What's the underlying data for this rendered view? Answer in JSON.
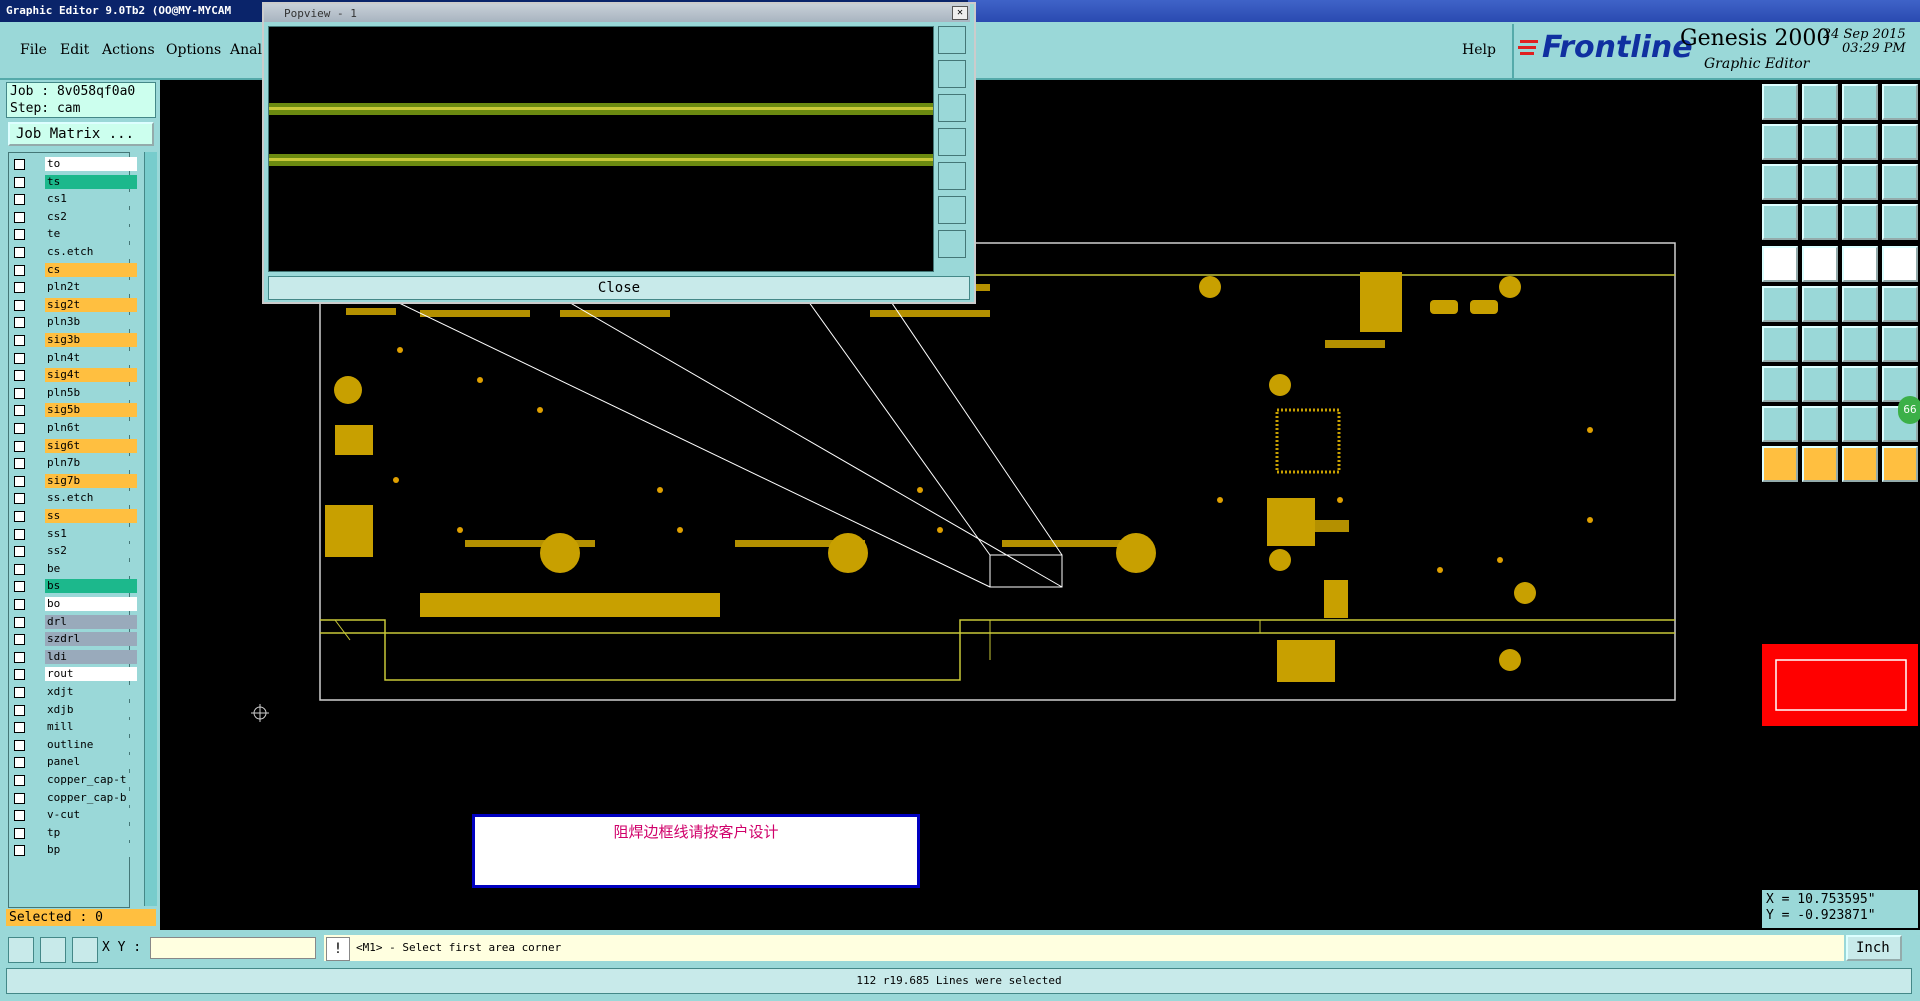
{
  "window": {
    "title": "Graphic Editor 9.0Tb2  (OO@MY-MYCAM"
  },
  "menu": {
    "file": "File",
    "edit": "Edit",
    "actions": "Actions",
    "options": "Options",
    "analysis": "Anal",
    "help": "Help"
  },
  "brand": {
    "logo": "Frontline",
    "product": "Genesis 2000",
    "subtitle": "Graphic Editor",
    "date": "24 Sep 2015",
    "time": "03:29 PM"
  },
  "job": {
    "job_line": "Job : 8v058qf0a0",
    "step_line": "Step: cam",
    "matrix_button": "Job Matrix ..."
  },
  "layers": [
    {
      "name": "to",
      "style": "w"
    },
    {
      "name": "ts",
      "style": "g"
    },
    {
      "name": "cs1",
      "style": "c"
    },
    {
      "name": "cs2",
      "style": "c"
    },
    {
      "name": "te",
      "style": "c"
    },
    {
      "name": "cs.etch",
      "style": "c"
    },
    {
      "name": "cs",
      "style": "o"
    },
    {
      "name": "pln2t",
      "style": "c"
    },
    {
      "name": "sig2t",
      "style": "o"
    },
    {
      "name": "pln3b",
      "style": "c"
    },
    {
      "name": "sig3b",
      "style": "o"
    },
    {
      "name": "pln4t",
      "style": "c"
    },
    {
      "name": "sig4t",
      "style": "o"
    },
    {
      "name": "pln5b",
      "style": "c"
    },
    {
      "name": "sig5b",
      "style": "o"
    },
    {
      "name": "pln6t",
      "style": "c"
    },
    {
      "name": "sig6t",
      "style": "o"
    },
    {
      "name": "pln7b",
      "style": "c"
    },
    {
      "name": "sig7b",
      "style": "o"
    },
    {
      "name": "ss.etch",
      "style": "c"
    },
    {
      "name": "ss",
      "style": "o"
    },
    {
      "name": "ss1",
      "style": "c"
    },
    {
      "name": "ss2",
      "style": "c"
    },
    {
      "name": "be",
      "style": "c"
    },
    {
      "name": "bs",
      "style": "g"
    },
    {
      "name": "bo",
      "style": "w"
    },
    {
      "name": "drl",
      "style": "gray"
    },
    {
      "name": "szdrl",
      "style": "gray"
    },
    {
      "name": "ldi",
      "style": "gray"
    },
    {
      "name": "rout",
      "style": "w"
    },
    {
      "name": "xdjt",
      "style": "c"
    },
    {
      "name": "xdjb",
      "style": "c"
    },
    {
      "name": "mill",
      "style": "c"
    },
    {
      "name": "outline",
      "style": "c"
    },
    {
      "name": "panel",
      "style": "c"
    },
    {
      "name": "copper_cap-t",
      "style": "c"
    },
    {
      "name": "copper_cap-b",
      "style": "c"
    },
    {
      "name": "v-cut",
      "style": "c"
    },
    {
      "name": "tp",
      "style": "c"
    },
    {
      "name": "bp",
      "style": "c"
    }
  ],
  "selected": "Selected : 0",
  "popview": {
    "title": "Popview - 1",
    "close_label": "Close"
  },
  "note": {
    "text": "阻焊边框线请按客户设计"
  },
  "coords": {
    "x": "X = 10.753595\"",
    "y": "Y = -0.923871\""
  },
  "xy": {
    "label": "X Y :",
    "value": ""
  },
  "prompt": {
    "text": "<M1> - Select first area corner"
  },
  "units": {
    "label": "Inch"
  },
  "status": {
    "text": "112 r19.685 Lines were selected"
  },
  "badge": {
    "text": "66"
  },
  "colors": {
    "panel": "#9ad8d8",
    "pad": "#c8a000",
    "outline_trace": "#c8c838",
    "highlight": "#ffbf40"
  }
}
